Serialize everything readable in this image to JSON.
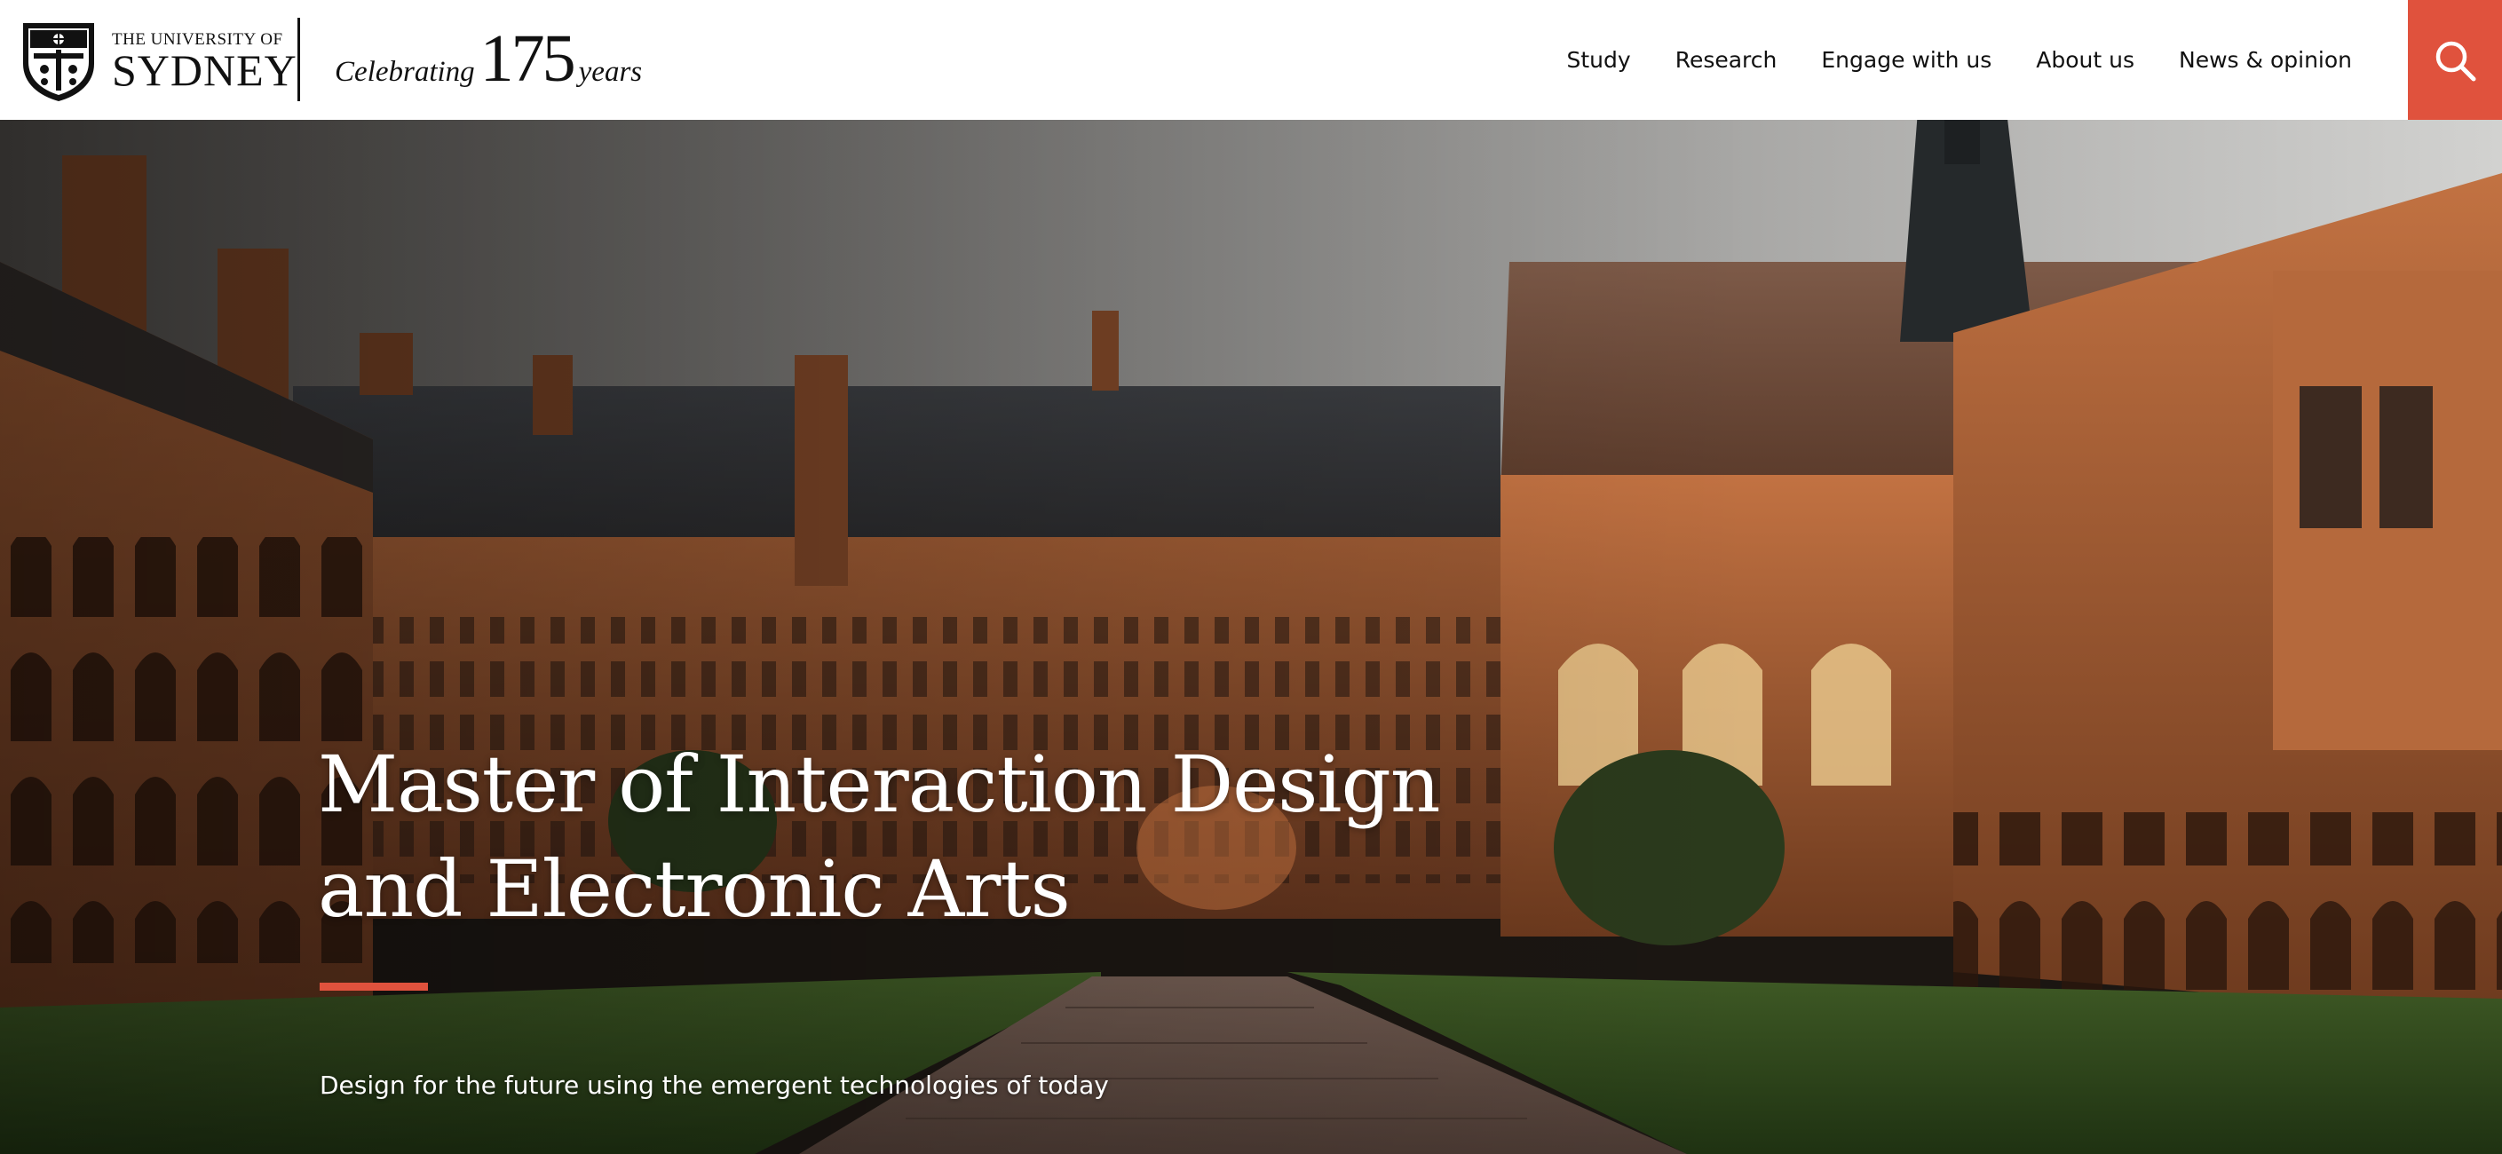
{
  "header": {
    "logo": {
      "line1": "THE UNIVERSITY OF",
      "line2": "SYDNEY",
      "crest_icon": "university-crest-icon"
    },
    "tagline": {
      "word": "Celebrating",
      "number": "175",
      "unit": "years"
    },
    "nav": [
      {
        "label": "Study"
      },
      {
        "label": "Research"
      },
      {
        "label": "Engage with us"
      },
      {
        "label": "About us"
      },
      {
        "label": "News & opinion"
      }
    ],
    "search": {
      "icon": "search-icon"
    }
  },
  "hero": {
    "title_line1": "Master of Interaction Design",
    "title_line2": "and Electronic Arts",
    "subtitle": "Design for the future using the emergent technologies of today",
    "image": "sandstone-quadrangle-photo"
  },
  "colors": {
    "accent": "#e0523d",
    "header_bg": "#ffffff",
    "text_dark": "#111111",
    "hero_text": "#ffffff"
  }
}
